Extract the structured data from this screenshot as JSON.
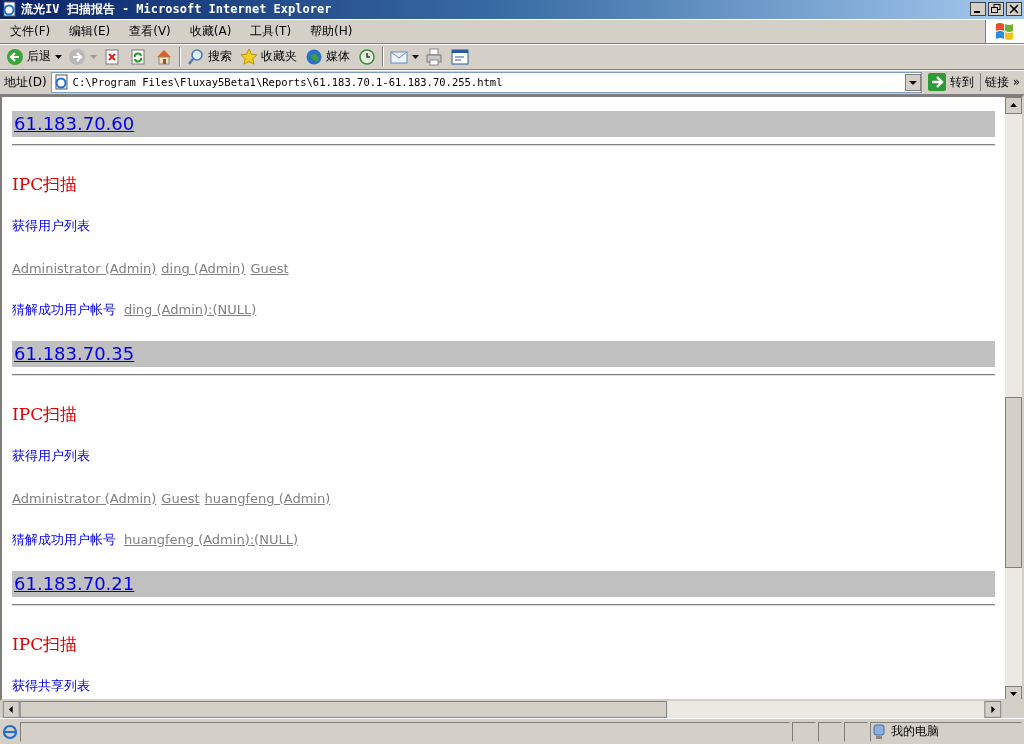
{
  "window": {
    "title": "流光IV 扫描报告 - Microsoft Internet Explorer"
  },
  "menu": [
    "文件(F)",
    "编辑(E)",
    "查看(V)",
    "收藏(A)",
    "工具(T)",
    "帮助(H)"
  ],
  "toolbar": [
    {
      "kind": "back",
      "label": "后退"
    },
    {
      "kind": "forward"
    },
    {
      "kind": "stop"
    },
    {
      "kind": "refresh"
    },
    {
      "kind": "home"
    },
    {
      "kind": "sep"
    },
    {
      "kind": "search",
      "label": "搜索"
    },
    {
      "kind": "favorites",
      "label": "收藏夹"
    },
    {
      "kind": "media",
      "label": "媒体"
    },
    {
      "kind": "history"
    },
    {
      "kind": "sep"
    },
    {
      "kind": "mail"
    },
    {
      "kind": "print"
    },
    {
      "kind": "edit"
    }
  ],
  "address": {
    "label": "地址(D)",
    "value": "C:\\Program Files\\Fluxay5Beta1\\Reports\\61.183.70.1-61.183.70.255.html",
    "go": "转到",
    "links": "链接",
    "more": "»"
  },
  "hosts": [
    {
      "ip": "61.183.70.60",
      "blocks": [
        {
          "kind": "heading",
          "text": "IPC扫描"
        },
        {
          "kind": "label",
          "text": "获得用户列表"
        },
        {
          "kind": "links",
          "links": [
            "Administrator (Admin)",
            "ding (Admin)",
            "Guest"
          ]
        },
        {
          "kind": "label-links",
          "text": "猜解成功用户帐号",
          "links": [
            "ding (Admin):(NULL)"
          ]
        }
      ]
    },
    {
      "ip": "61.183.70.35",
      "blocks": [
        {
          "kind": "heading",
          "text": "IPC扫描"
        },
        {
          "kind": "label",
          "text": "获得用户列表"
        },
        {
          "kind": "links",
          "links": [
            "Administrator (Admin)",
            "Guest",
            "huangfeng (Admin)"
          ]
        },
        {
          "kind": "label-links",
          "text": "猜解成功用户帐号",
          "links": [
            "huangfeng (Admin):(NULL)"
          ]
        }
      ]
    },
    {
      "ip": "61.183.70.21",
      "blocks": [
        {
          "kind": "heading",
          "text": "IPC扫描"
        },
        {
          "kind": "label",
          "text": "获得共享列表"
        }
      ]
    }
  ],
  "status_bar": {
    "zone": "我的电脑"
  }
}
